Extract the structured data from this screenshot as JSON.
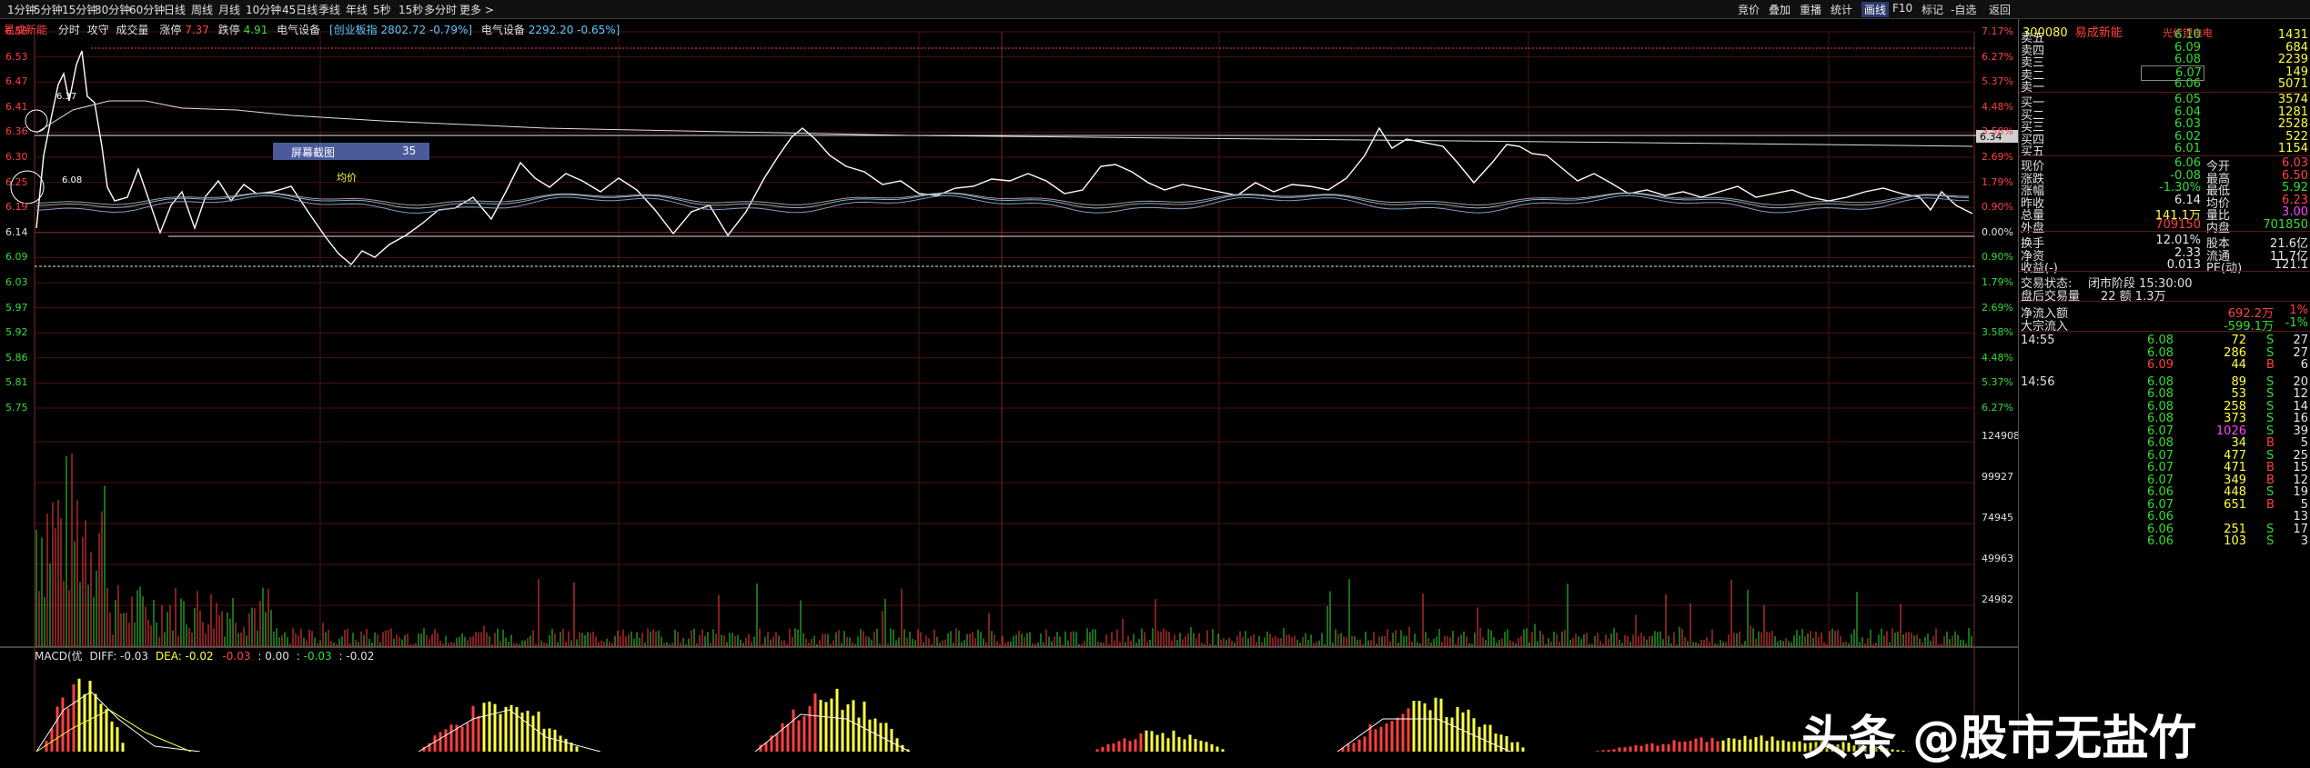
{
  "topbar": {
    "items": [
      "1分钟",
      "5分钟",
      "15分钟",
      "30分钟",
      "60分钟",
      "日线",
      "周线",
      "月线",
      "10分钟",
      "45日线",
      "季线",
      "年线",
      "5秒",
      "15秒",
      "多分时",
      "更多 >"
    ],
    "right": [
      "竞价",
      "叠加",
      "重播",
      "统计",
      "画线",
      "F10",
      "标记",
      "-自选",
      "返回"
    ]
  },
  "info": {
    "name": "易成新能",
    "tabs": [
      "分时",
      "攻守",
      "成交量"
    ],
    "limit_up_label": "涨停",
    "limit_up": "7.37",
    "limit_down_label": "跌停",
    "limit_down": "4.91",
    "sector1": "电气设备",
    "sector2": "[创业板指",
    "sector2_val": "2802.72 -0.79%]",
    "sector3": "电气设备",
    "sector3_val": "2292.20 -0.65%]"
  },
  "axes": {
    "prices": [
      "6.58",
      "6.53",
      "6.47",
      "6.41",
      "6.36",
      "6.30",
      "6.25",
      "6.19",
      "6.14",
      "6.09",
      "6.03",
      "5.97",
      "5.92",
      "5.86",
      "5.81",
      "5.75"
    ],
    "pcts": [
      "7.17%",
      "6.27%",
      "5.37%",
      "4.48%",
      "3.58%",
      "2.69%",
      "1.79%",
      "0.90%",
      "0.00%",
      "0.90%",
      "1.79%",
      "2.69%",
      "3.58%",
      "4.48%",
      "5.37%",
      "6.27%"
    ],
    "vols": [
      "124908",
      "99927",
      "74945",
      "49963",
      "24982"
    ],
    "price_tag": "6.34"
  },
  "annotations": {
    "high_label": "6.37",
    "low_label": "6.08",
    "avg_label": "均价",
    "screenshot_label": "屏幕截图",
    "screenshot_num": "35"
  },
  "macd": {
    "label": "MACD(优",
    "diff": "DIFF: -0.03",
    "dea": "DEA: -0.02",
    "m1": "-0.03",
    "m2": "0.00",
    "m3": "-0.03",
    "m4": "-0.02"
  },
  "quote": {
    "code": "300080",
    "name": "易成新能",
    "sector": "光伏锂电电",
    "asks": [
      {
        "label": "卖五",
        "price": "6.10",
        "vol": "1431"
      },
      {
        "label": "卖四",
        "price": "6.09",
        "vol": "684"
      },
      {
        "label": "卖三",
        "price": "6.08",
        "vol": "2239"
      },
      {
        "label": "卖二",
        "price": "6.07",
        "vol": "149"
      },
      {
        "label": "卖一",
        "price": "6.06",
        "vol": "5071"
      }
    ],
    "bids": [
      {
        "label": "买一",
        "price": "6.05",
        "vol": "3574"
      },
      {
        "label": "买二",
        "price": "6.04",
        "vol": "1281"
      },
      {
        "label": "买三",
        "price": "6.03",
        "vol": "2528"
      },
      {
        "label": "买四",
        "price": "6.02",
        "vol": "522"
      },
      {
        "label": "买五",
        "price": "6.01",
        "vol": "1154"
      }
    ],
    "stats": [
      {
        "l1": "现价",
        "v1": "6.06",
        "l2": "今开",
        "v2": "6.03"
      },
      {
        "l1": "涨跌",
        "v1": "-0.08",
        "l2": "最高",
        "v2": "6.50"
      },
      {
        "l1": "涨幅",
        "v1": "-1.30%",
        "l2": "最低",
        "v2": "5.92"
      },
      {
        "l1": "昨收",
        "v1": "6.14",
        "l2": "均价",
        "v2": "6.23"
      },
      {
        "l1": "总量",
        "v1": "141.1万",
        "l2": "量比",
        "v2": "3.00"
      },
      {
        "l1": "外盘",
        "v1": "709150",
        "l2": "内盘",
        "v2": "701850"
      }
    ],
    "stats2": [
      {
        "l1": "换手",
        "v1": "12.01%",
        "l2": "股本",
        "v2": "21.6亿"
      },
      {
        "l1": "净资",
        "v1": "2.33",
        "l2": "流通",
        "v2": "11.7亿"
      },
      {
        "l1": "收益(-)",
        "v1": "0.013",
        "l2": "PE(动)",
        "v2": "121.1"
      }
    ],
    "status_label": "交易状态:",
    "status": "闭市阶段 15:30:00",
    "after_label": "盘后交易量",
    "after": "22 额 1.3万",
    "flows": [
      {
        "label": "净流入额",
        "val": "692.2万",
        "pct": "1%"
      },
      {
        "label": "大宗流入",
        "val": "-599.1万",
        "pct": "-1%"
      }
    ],
    "ticks": [
      {
        "time": "14:55",
        "price": "6.08",
        "vol": "72",
        "bs": "S",
        "n": "27"
      },
      {
        "time": "",
        "price": "6.08",
        "vol": "286",
        "bs": "S",
        "n": "27"
      },
      {
        "time": "",
        "price": "6.09",
        "vol": "44",
        "bs": "B",
        "n": "6"
      },
      {
        "time": "14:56",
        "price": "6.08",
        "vol": "89",
        "bs": "S",
        "n": "20"
      },
      {
        "time": "",
        "price": "6.08",
        "vol": "53",
        "bs": "S",
        "n": "12"
      },
      {
        "time": "",
        "price": "6.08",
        "vol": "258",
        "bs": "S",
        "n": "14"
      },
      {
        "time": "",
        "price": "6.08",
        "vol": "373",
        "bs": "S",
        "n": "16"
      },
      {
        "time": "",
        "price": "6.07",
        "vol": "1026",
        "bs": "S",
        "n": "39"
      },
      {
        "time": "",
        "price": "6.08",
        "vol": "34",
        "bs": "B",
        "n": "5"
      },
      {
        "time": "",
        "price": "6.07",
        "vol": "477",
        "bs": "S",
        "n": "25"
      },
      {
        "time": "",
        "price": "6.07",
        "vol": "471",
        "bs": "B",
        "n": "15"
      },
      {
        "time": "",
        "price": "6.07",
        "vol": "349",
        "bs": "B",
        "n": "12"
      },
      {
        "time": "",
        "price": "6.06",
        "vol": "448",
        "bs": "S",
        "n": "19"
      },
      {
        "time": "",
        "price": "6.07",
        "vol": "651",
        "bs": "B",
        "n": "5"
      },
      {
        "time": "",
        "price": "6.06",
        "vol": "",
        "bs": "",
        "n": "13"
      },
      {
        "time": "",
        "price": "6.06",
        "vol": "251",
        "bs": "S",
        "n": "17"
      },
      {
        "time": "",
        "price": "6.06",
        "vol": "103",
        "bs": "S",
        "n": "3"
      }
    ]
  },
  "watermark": "头条 @股市无盐竹",
  "colors": {
    "up": "#ff4040",
    "down": "#33dd33",
    "grid": "#5a1a1a",
    "price_line": "#ffffff",
    "avg_line": "#ffff44"
  }
}
